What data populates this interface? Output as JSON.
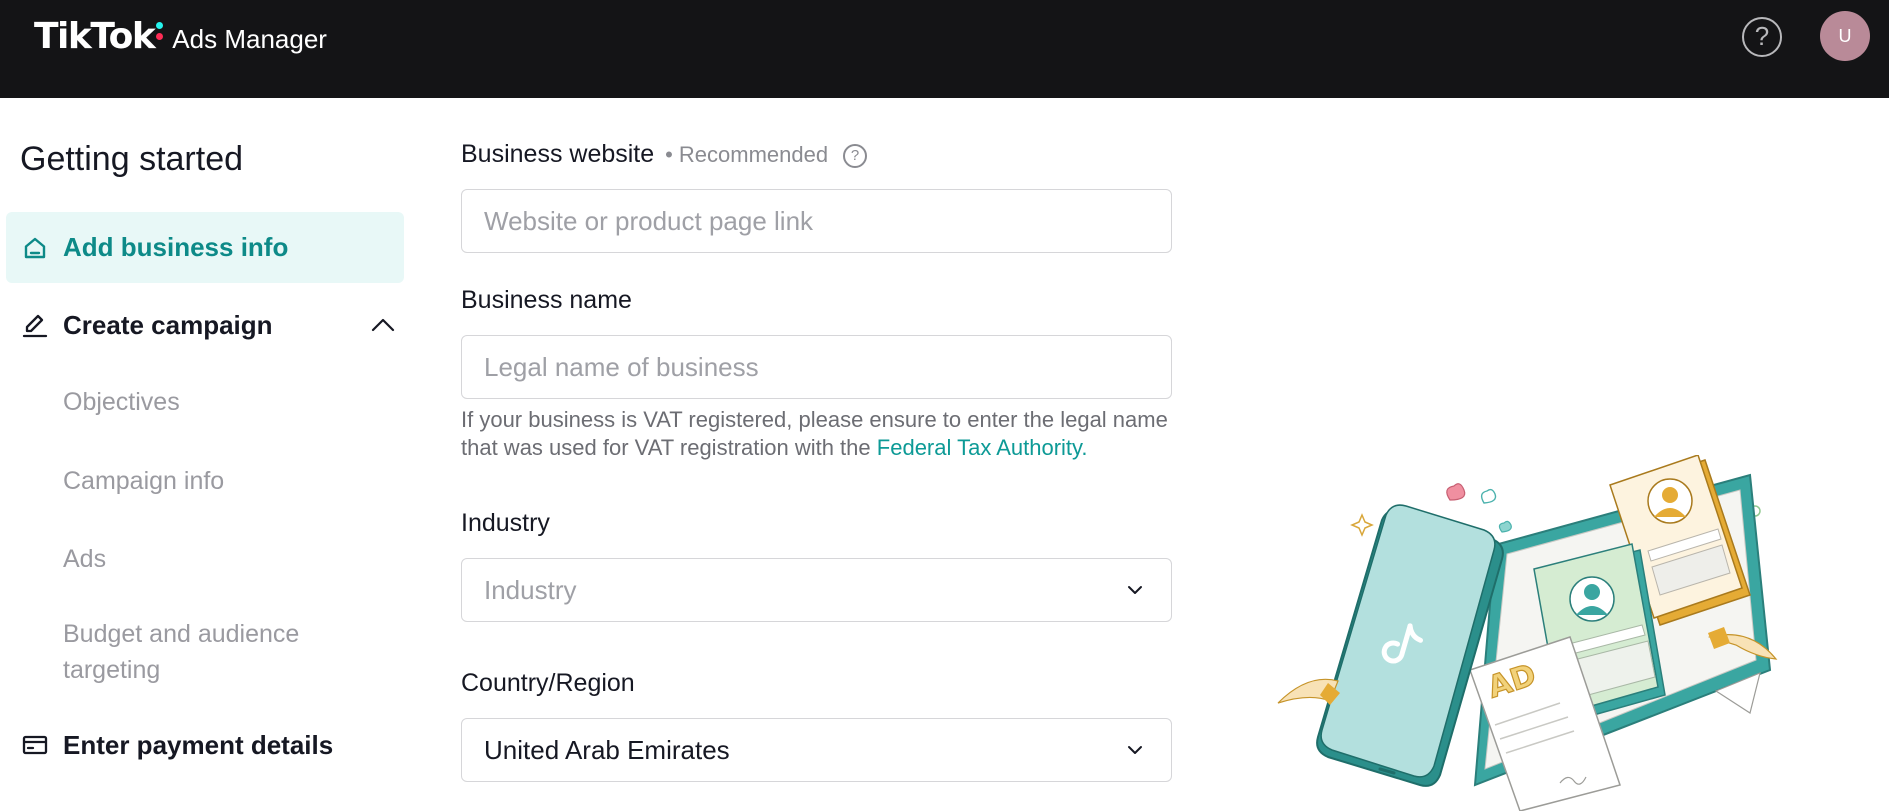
{
  "header": {
    "logo_text": "TikTok",
    "product_name": "Ads Manager",
    "help_icon": "question-circle-icon",
    "avatar_initial": "U",
    "colors": {
      "background": "#141416",
      "logo_accent_red": "#fe2c55",
      "logo_accent_cyan": "#25f4ee",
      "avatar": "#b98a98"
    }
  },
  "sidebar": {
    "title": "Getting started",
    "steps": [
      {
        "label": "Add business info",
        "icon": "home-icon",
        "active": true
      },
      {
        "label": "Create campaign",
        "icon": "pencil-icon",
        "expanded": true,
        "substeps": [
          "Objectives",
          "Campaign info",
          "Ads",
          "Budget and audience targeting"
        ]
      },
      {
        "label": "Enter payment details",
        "icon": "credit-card-icon"
      }
    ],
    "colors": {
      "active_bg": "#e8f8f7",
      "active_text": "#0d8a88"
    }
  },
  "form": {
    "business_website": {
      "label": "Business website",
      "tag": "• Recommended",
      "placeholder": "Website or product page link",
      "value": ""
    },
    "business_name": {
      "label": "Business name",
      "placeholder": "Legal name of business",
      "value": "",
      "help_text": "If your business is VAT registered, please ensure to enter the legal name that was used for VAT registration with the",
      "help_link": "Federal Tax Authority."
    },
    "industry": {
      "label": "Industry",
      "placeholder": "Industry",
      "value": ""
    },
    "country_region": {
      "label": "Country/Region",
      "value": "United Arab Emirates"
    },
    "colors": {
      "link": "#0d9a96",
      "border": "#d6d6d9"
    }
  },
  "illustration": {
    "ad_label": "AD"
  }
}
